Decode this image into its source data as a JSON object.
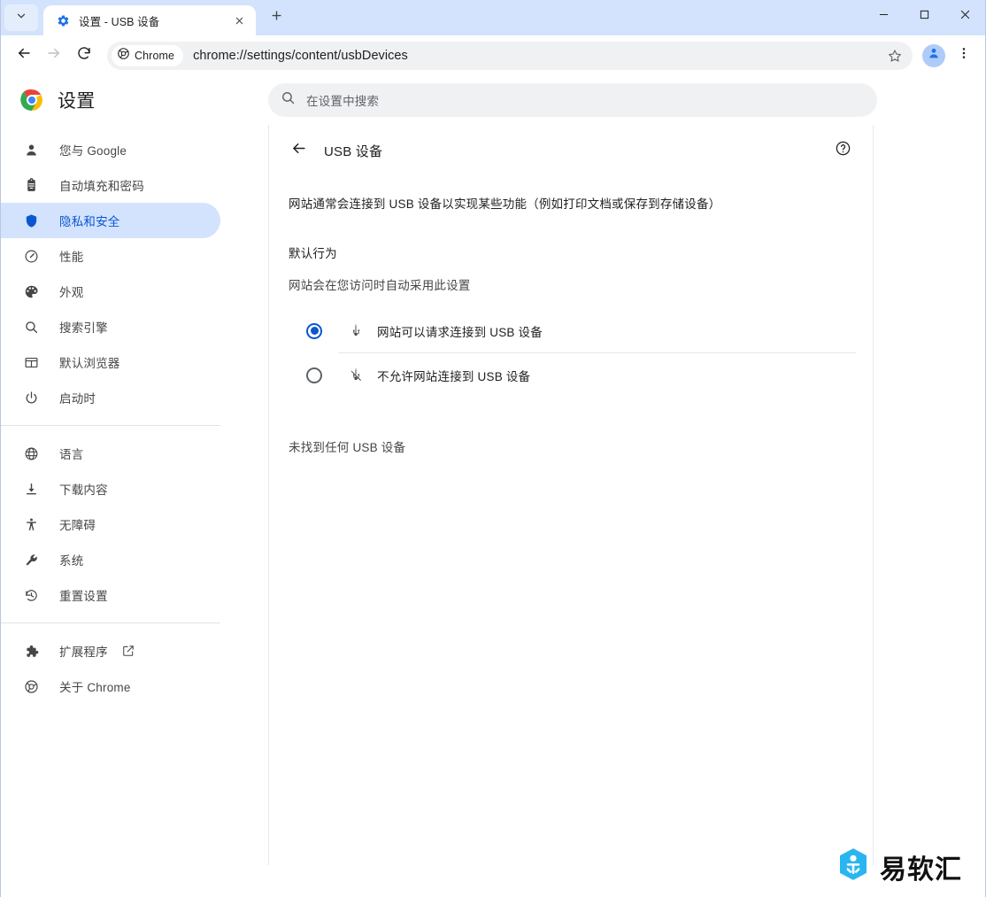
{
  "window": {
    "tab_search_icon": "chevron-down-icon",
    "minimize_label": "minimize",
    "maximize_label": "maximize",
    "close_label": "close"
  },
  "tab": {
    "title": "设置 - USB 设备",
    "favicon": "settings-gear-icon",
    "close_icon": "close-icon",
    "new_tab_icon": "plus-icon"
  },
  "toolbar": {
    "back_icon": "back-arrow-icon",
    "forward_icon": "forward-arrow-icon",
    "reload_icon": "reload-icon",
    "chrome_chip_label": "Chrome",
    "url": "chrome://settings/content/usbDevices",
    "star_icon": "star-icon",
    "avatar_icon": "profile-avatar-icon",
    "menu_icon": "three-dot-menu-icon"
  },
  "settings_header": {
    "logo": "chrome-logo-icon",
    "title": "设置",
    "search_icon": "search-icon",
    "search_placeholder": "在设置中搜索",
    "search_value": ""
  },
  "sidebar": {
    "groups": [
      {
        "items": [
          {
            "label": "您与 Google",
            "icon": "person-icon",
            "active": false
          },
          {
            "label": "自动填充和密码",
            "icon": "clipboard-icon",
            "active": false
          },
          {
            "label": "隐私和安全",
            "icon": "shield-icon",
            "active": true
          },
          {
            "label": "性能",
            "icon": "speedometer-icon",
            "active": false
          },
          {
            "label": "外观",
            "icon": "palette-icon",
            "active": false
          },
          {
            "label": "搜索引擎",
            "icon": "search-icon",
            "active": false
          },
          {
            "label": "默认浏览器",
            "icon": "browser-window-icon",
            "active": false
          },
          {
            "label": "启动时",
            "icon": "power-icon",
            "active": false
          }
        ]
      },
      {
        "items": [
          {
            "label": "语言",
            "icon": "globe-icon",
            "active": false
          },
          {
            "label": "下载内容",
            "icon": "download-icon",
            "active": false
          },
          {
            "label": "无障碍",
            "icon": "accessibility-icon",
            "active": false
          },
          {
            "label": "系统",
            "icon": "wrench-icon",
            "active": false
          },
          {
            "label": "重置设置",
            "icon": "history-restore-icon",
            "active": false
          }
        ]
      },
      {
        "items": [
          {
            "label": "扩展程序",
            "icon": "puzzle-icon",
            "active": false,
            "external": true
          },
          {
            "label": "关于 Chrome",
            "icon": "chrome-outline-icon",
            "active": false
          }
        ]
      }
    ]
  },
  "main": {
    "back_icon": "back-arrow-icon",
    "page_title": "USB 设备",
    "help_icon": "help-circle-icon",
    "description": "网站通常会连接到 USB 设备以实现某些功能（例如打印文档或保存到存储设备）",
    "default_behavior_label": "默认行为",
    "default_behavior_sublabel": "网站会在您访问时自动采用此设置",
    "options": [
      {
        "label": "网站可以请求连接到 USB 设备",
        "icon": "usb-icon",
        "selected": true
      },
      {
        "label": "不允许网站连接到 USB 设备",
        "icon": "usb-off-icon",
        "selected": false
      }
    ],
    "empty_state": "未找到任何 USB 设备"
  },
  "watermark": {
    "text": "易软汇",
    "logo": "yiruanhui-logo-icon",
    "color": "#29b6f0"
  },
  "colors": {
    "accent_blue": "#0b57d0",
    "active_pill": "#d3e3fd",
    "tabstrip": "#d3e3fd",
    "omnibox": "#eff1f3",
    "text_primary": "#1f1f1f",
    "text_secondary": "#444746",
    "divider": "#e6e8eb"
  }
}
